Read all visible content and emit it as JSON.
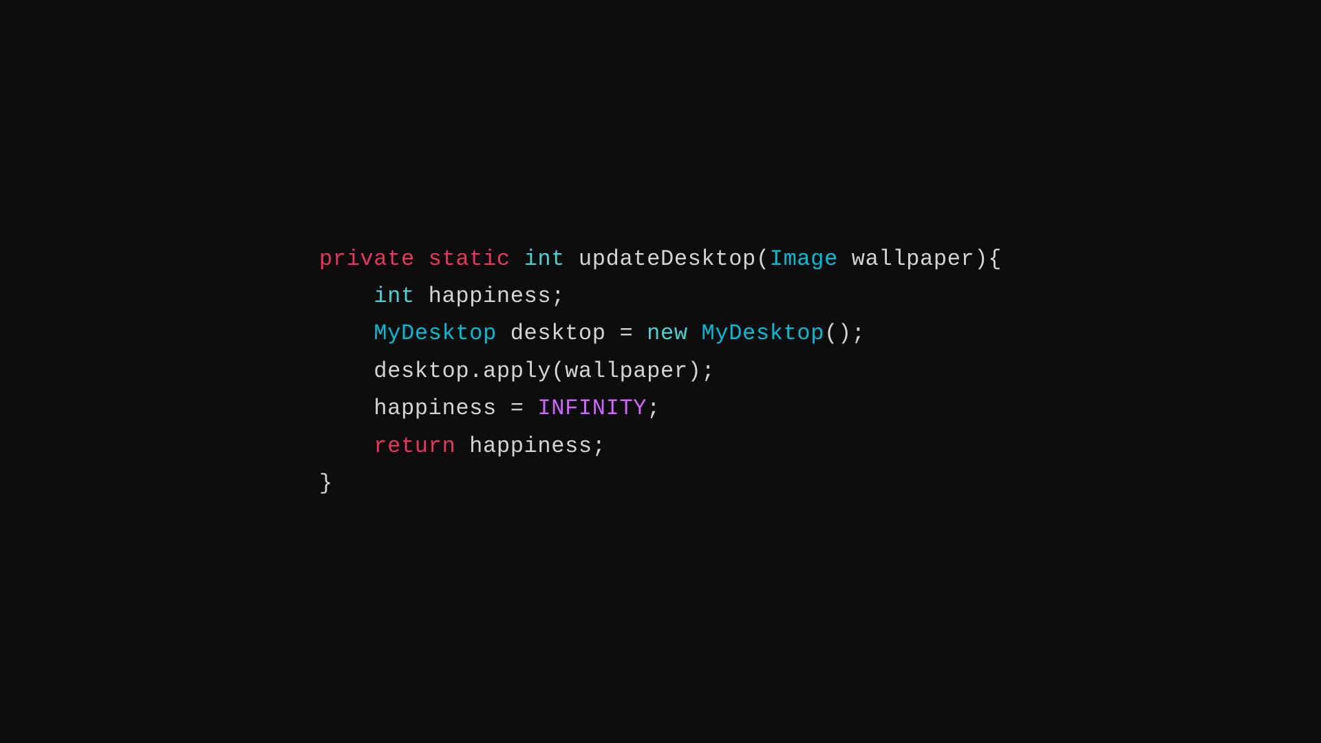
{
  "code": {
    "lines": [
      {
        "id": "line1",
        "parts": [
          {
            "text": "private",
            "cls": "kw-private"
          },
          {
            "text": " ",
            "cls": ""
          },
          {
            "text": "static",
            "cls": "kw-static"
          },
          {
            "text": " ",
            "cls": ""
          },
          {
            "text": "int",
            "cls": "kw-int-ret"
          },
          {
            "text": " updateDesktop(",
            "cls": "fn-name"
          },
          {
            "text": "Image",
            "cls": "class-image"
          },
          {
            "text": " wallpaper){",
            "cls": "fn-name"
          }
        ]
      },
      {
        "id": "line2",
        "parts": [
          {
            "text": "    ",
            "cls": ""
          },
          {
            "text": "int",
            "cls": "kw-int"
          },
          {
            "text": " happiness;",
            "cls": "var"
          }
        ]
      },
      {
        "id": "line3",
        "parts": [
          {
            "text": "    ",
            "cls": ""
          },
          {
            "text": "MyDesktop",
            "cls": "class-mydesktop"
          },
          {
            "text": " desktop = ",
            "cls": "var"
          },
          {
            "text": "new",
            "cls": "kw-new"
          },
          {
            "text": " ",
            "cls": ""
          },
          {
            "text": "MyDesktop",
            "cls": "class-mydesktop"
          },
          {
            "text": "();",
            "cls": "var"
          }
        ]
      },
      {
        "id": "line4",
        "parts": [
          {
            "text": "    desktop.apply(wallpaper);",
            "cls": "var"
          }
        ]
      },
      {
        "id": "line5",
        "parts": [
          {
            "text": "    happiness = ",
            "cls": "var"
          },
          {
            "text": "INFINITY",
            "cls": "constant"
          },
          {
            "text": ";",
            "cls": "var"
          }
        ]
      },
      {
        "id": "line6",
        "parts": [
          {
            "text": "    ",
            "cls": ""
          },
          {
            "text": "return",
            "cls": "kw-return"
          },
          {
            "text": " happiness;",
            "cls": "var"
          }
        ]
      },
      {
        "id": "line7",
        "parts": [
          {
            "text": "}",
            "cls": "brace"
          }
        ]
      }
    ]
  }
}
